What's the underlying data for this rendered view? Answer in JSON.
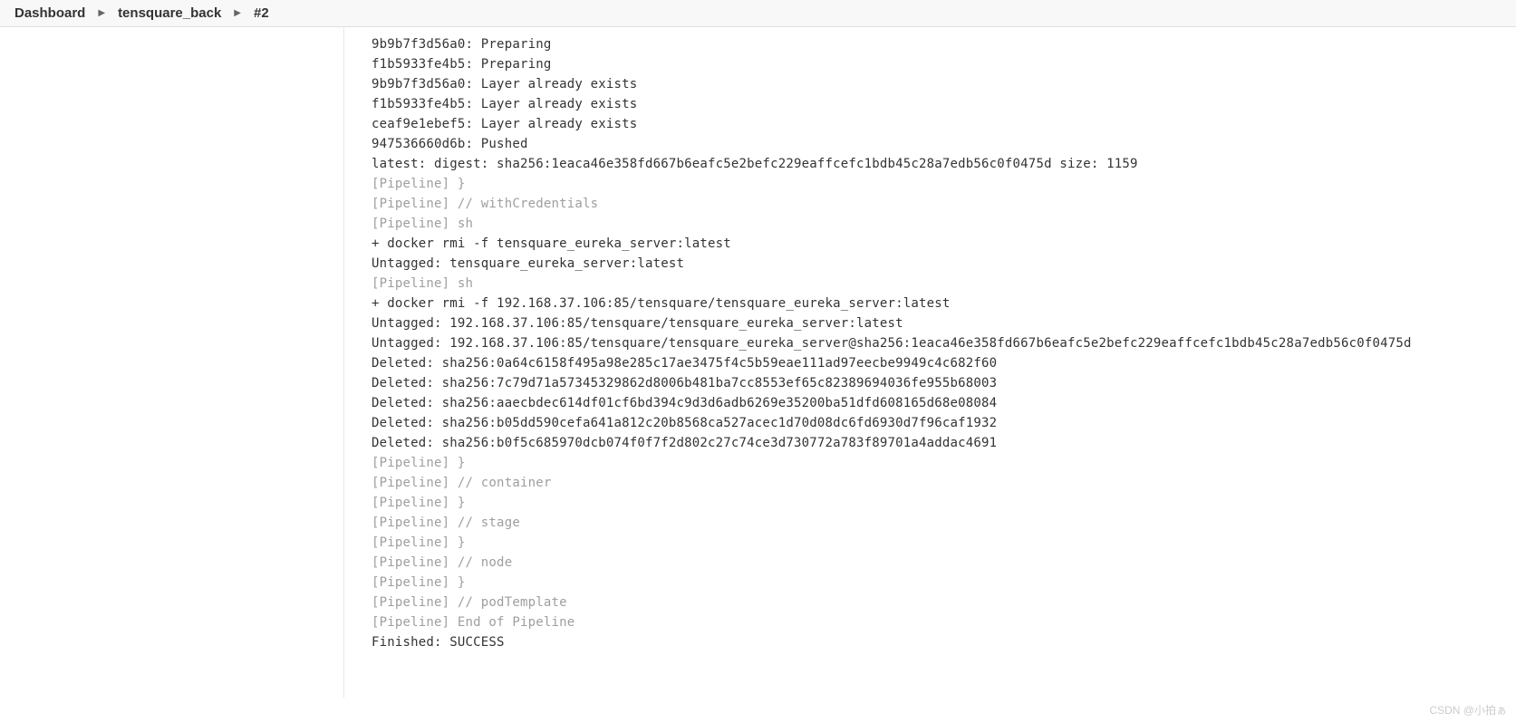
{
  "breadcrumb": {
    "items": [
      "Dashboard",
      "tensquare_back",
      "#2"
    ],
    "separator": "▶"
  },
  "console": {
    "lines": [
      {
        "t": "9b9b7f3d56a0: Preparing",
        "dim": false
      },
      {
        "t": "f1b5933fe4b5: Preparing",
        "dim": false
      },
      {
        "t": "9b9b7f3d56a0: Layer already exists",
        "dim": false
      },
      {
        "t": "f1b5933fe4b5: Layer already exists",
        "dim": false
      },
      {
        "t": "ceaf9e1ebef5: Layer already exists",
        "dim": false
      },
      {
        "t": "947536660d6b: Pushed",
        "dim": false
      },
      {
        "t": "latest: digest: sha256:1eaca46e358fd667b6eafc5e2befc229eaffcefc1bdb45c28a7edb56c0f0475d size: 1159",
        "dim": false
      },
      {
        "t": "[Pipeline] }",
        "dim": true
      },
      {
        "t": "[Pipeline] // withCredentials",
        "dim": true
      },
      {
        "t": "[Pipeline] sh",
        "dim": true
      },
      {
        "t": "+ docker rmi -f tensquare_eureka_server:latest",
        "dim": false
      },
      {
        "t": "Untagged: tensquare_eureka_server:latest",
        "dim": false
      },
      {
        "t": "[Pipeline] sh",
        "dim": true
      },
      {
        "t": "+ docker rmi -f 192.168.37.106:85/tensquare/tensquare_eureka_server:latest",
        "dim": false
      },
      {
        "t": "Untagged: 192.168.37.106:85/tensquare/tensquare_eureka_server:latest",
        "dim": false
      },
      {
        "t": "Untagged: 192.168.37.106:85/tensquare/tensquare_eureka_server@sha256:1eaca46e358fd667b6eafc5e2befc229eaffcefc1bdb45c28a7edb56c0f0475d",
        "dim": false
      },
      {
        "t": "Deleted: sha256:0a64c6158f495a98e285c17ae3475f4c5b59eae111ad97eecbe9949c4c682f60",
        "dim": false
      },
      {
        "t": "Deleted: sha256:7c79d71a57345329862d8006b481ba7cc8553ef65c82389694036fe955b68003",
        "dim": false
      },
      {
        "t": "Deleted: sha256:aaecbdec614df01cf6bd394c9d3d6adb6269e35200ba51dfd608165d68e08084",
        "dim": false
      },
      {
        "t": "Deleted: sha256:b05dd590cefa641a812c20b8568ca527acec1d70d08dc6fd6930d7f96caf1932",
        "dim": false
      },
      {
        "t": "Deleted: sha256:b0f5c685970dcb074f0f7f2d802c27c74ce3d730772a783f89701a4addac4691",
        "dim": false
      },
      {
        "t": "[Pipeline] }",
        "dim": true
      },
      {
        "t": "[Pipeline] // container",
        "dim": true
      },
      {
        "t": "[Pipeline] }",
        "dim": true
      },
      {
        "t": "[Pipeline] // stage",
        "dim": true
      },
      {
        "t": "[Pipeline] }",
        "dim": true
      },
      {
        "t": "[Pipeline] // node",
        "dim": true
      },
      {
        "t": "[Pipeline] }",
        "dim": true
      },
      {
        "t": "[Pipeline] // podTemplate",
        "dim": true
      },
      {
        "t": "[Pipeline] End of Pipeline",
        "dim": true
      },
      {
        "t": "Finished: SUCCESS",
        "dim": false
      }
    ]
  },
  "watermark": "CSDN @小拍ぁ"
}
